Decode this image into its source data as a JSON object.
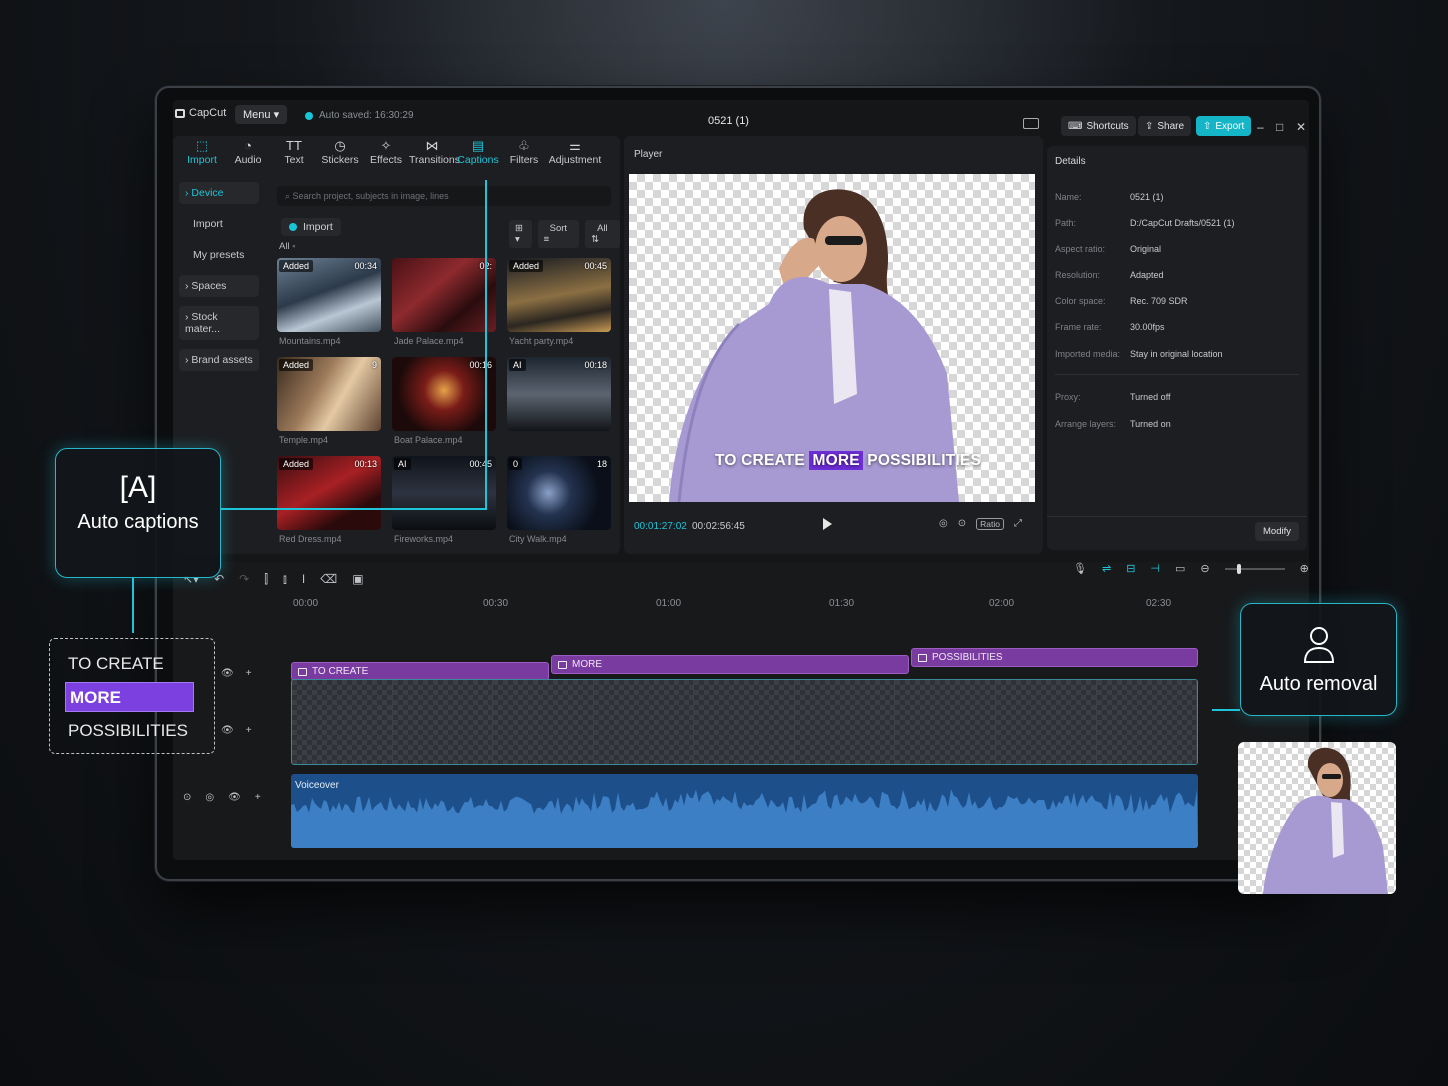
{
  "app": {
    "name": "CapCut",
    "menu_label": "Menu",
    "autosave": "Auto saved: 16:30:29",
    "project_title": "0521 (1)",
    "shortcuts_label": "Shortcuts",
    "share_label": "Share",
    "export_label": "Export",
    "accent_color": "#20c4d8"
  },
  "media_tabs": [
    {
      "label": "Import",
      "icon": "import-icon",
      "active": true
    },
    {
      "label": "Audio",
      "icon": "audio-icon"
    },
    {
      "label": "Text",
      "icon": "text-icon"
    },
    {
      "label": "Stickers",
      "icon": "sticker-icon"
    },
    {
      "label": "Effects",
      "icon": "effects-icon"
    },
    {
      "label": "Transitions",
      "icon": "transitions-icon"
    },
    {
      "label": "Captions",
      "icon": "captions-icon"
    },
    {
      "label": "Filters",
      "icon": "filters-icon"
    },
    {
      "label": "Adjustment",
      "icon": "adjustment-icon"
    }
  ],
  "side_nav": {
    "device": "› Device",
    "import": "Import",
    "presets": "My presets",
    "spaces": "› Spaces",
    "stock": "› Stock mater...",
    "brand": "› Brand assets"
  },
  "media": {
    "search_placeholder": "Search project, subjects in image, lines",
    "import_label": "Import",
    "sort_label": "Sort",
    "all_filter": "All",
    "all_label": "All",
    "items": [
      {
        "name": "Mountains.mp4",
        "badge": "Added",
        "duration": "00:34"
      },
      {
        "name": "Jade Palace.mp4",
        "badge": "",
        "duration": "02:"
      },
      {
        "name": "Yacht party.mp4",
        "badge": "Added",
        "duration": "00:45"
      },
      {
        "name": "Temple.mp4",
        "badge": "Added",
        "duration": "9"
      },
      {
        "name": "Boat Palace.mp4",
        "badge": "",
        "duration": "00:16"
      },
      {
        "name": "",
        "badge": "AI",
        "duration": "00:18"
      },
      {
        "name": "Red Dress.mp4",
        "badge": "Added",
        "duration": "00:13"
      },
      {
        "name": "Fireworks.mp4",
        "badge": "AI",
        "duration": "00:45"
      },
      {
        "name": "City Walk.mp4",
        "badge": "0",
        "duration": "18"
      }
    ]
  },
  "player": {
    "label": "Player",
    "caption_pre": "TO CREATE",
    "caption_hl": "MORE",
    "caption_post": "POSSIBILITIES",
    "current_time": "00:01:27:02",
    "total_time": "00:02:56:45",
    "ratio_label": "Ratio"
  },
  "details": {
    "title": "Details",
    "rows": [
      {
        "k": "Name:",
        "v": "0521 (1)"
      },
      {
        "k": "Path:",
        "v": "D:/CapCut Drafts/0521 (1)"
      },
      {
        "k": "Aspect ratio:",
        "v": "Original"
      },
      {
        "k": "Resolution:",
        "v": "Adapted"
      },
      {
        "k": "Color space:",
        "v": "Rec. 709 SDR"
      },
      {
        "k": "Frame rate:",
        "v": "30.00fps"
      },
      {
        "k": "Imported media:",
        "v": "Stay in original location"
      },
      {
        "k": "Proxy:",
        "v": "Turned off"
      },
      {
        "k": "Arrange layers:",
        "v": "Turned on"
      }
    ],
    "modify_label": "Modify"
  },
  "timeline": {
    "ruler": [
      "00:00",
      "00:30",
      "01:00",
      "01:30",
      "02:00",
      "02:30"
    ],
    "caption_clips": [
      "TO CREATE",
      "MORE",
      "POSSIBILITIES"
    ],
    "audio_label": "Voiceover"
  },
  "callouts": {
    "auto_captions": "Auto captions",
    "auto_removal": "Auto removal",
    "caption_list": [
      "TO CREATE",
      "MORE",
      "POSSIBILITIES"
    ]
  }
}
